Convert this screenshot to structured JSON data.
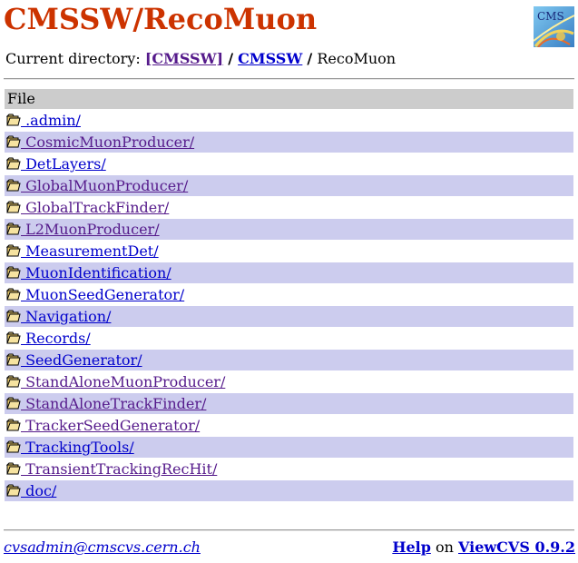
{
  "header": {
    "title": "CMSSW/RecoMuon",
    "logo_label": "CMS"
  },
  "breadcrumb": {
    "prefix": "Current directory:",
    "root_link": "[CMSSW]",
    "sep1": "/",
    "repo_link": "CMSSW",
    "sep2": "/",
    "current": "RecoMuon"
  },
  "listing": {
    "header": "File",
    "rows": [
      {
        "name": " .admin/",
        "visited": false
      },
      {
        "name": " CosmicMuonProducer/",
        "visited": true
      },
      {
        "name": " DetLayers/",
        "visited": false
      },
      {
        "name": " GlobalMuonProducer/",
        "visited": true
      },
      {
        "name": " GlobalTrackFinder/",
        "visited": true
      },
      {
        "name": " L2MuonProducer/",
        "visited": true
      },
      {
        "name": " MeasurementDet/",
        "visited": false
      },
      {
        "name": " MuonIdentification/",
        "visited": false
      },
      {
        "name": " MuonSeedGenerator/",
        "visited": false
      },
      {
        "name": " Navigation/",
        "visited": false
      },
      {
        "name": " Records/",
        "visited": false
      },
      {
        "name": " SeedGenerator/",
        "visited": false
      },
      {
        "name": " StandAloneMuonProducer/",
        "visited": true
      },
      {
        "name": " StandAloneTrackFinder/",
        "visited": true
      },
      {
        "name": " TrackerSeedGenerator/",
        "visited": true
      },
      {
        "name": " TrackingTools/",
        "visited": false
      },
      {
        "name": " TransientTrackingRecHit/",
        "visited": true
      },
      {
        "name": " doc/",
        "visited": false
      }
    ]
  },
  "footer": {
    "email": "cvsadmin@cmscvs.cern.ch",
    "help_link": "Help",
    "on_text": "on",
    "viewcvs_link": "ViewCVS 0.9.2"
  },
  "colors": {
    "title": "#cc3300",
    "row_even": "#ffffff",
    "row_odd": "#ccccee",
    "header_bg": "#cccccc",
    "link": "#0000cc",
    "link_visited": "#551a8b"
  },
  "icons": {
    "folder": "folder-icon",
    "logo": "cms-logo-icon"
  }
}
